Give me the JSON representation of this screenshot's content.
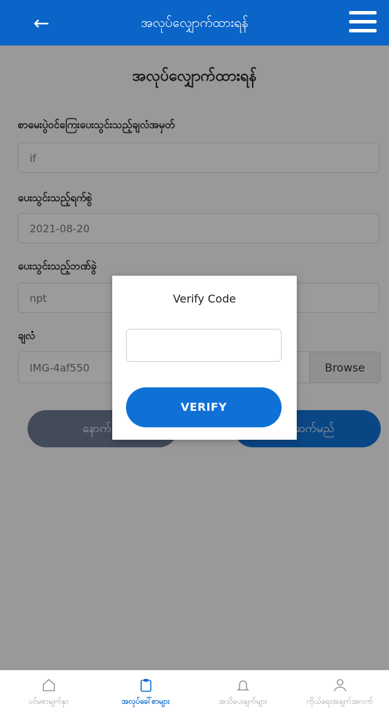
{
  "header": {
    "title": "အလုပ်လျှောက်ထားရန်",
    "back_icon": "arrow-left-icon",
    "menu_icon": "hamburger-menu-icon",
    "bg_color": "#0b64c8"
  },
  "form": {
    "title": "အလုပ်လျှောက်ထားရန်",
    "fields": [
      {
        "label": "စာမေးပွဲဝင်ကြေးပေးသွင်းသည့်ချလံအမှတ်",
        "value": "if"
      },
      {
        "label": "ပေးသွင်းသည့်ရက်စွဲ",
        "value": "2021-08-20"
      },
      {
        "label": "ပေးသွင်းသည့်ဘဏ်ခွဲ",
        "value": "npt"
      }
    ],
    "file": {
      "label": "ချလံ",
      "value": "IMG-4af550",
      "browse_label": "Browse"
    },
    "back_label": "နောက်သို့",
    "next_label": "ရှေ့ဆက်မည်"
  },
  "modal": {
    "title": "Verify Code",
    "input_value": "",
    "button_label": "VERIFY",
    "accent": "#0f71d6"
  },
  "bottom_nav": {
    "items": [
      {
        "label": "ပင်မစာမျက်နှာ",
        "icon": "home-icon"
      },
      {
        "label": "အလုပ်ခေါ်စာများ",
        "icon": "clipboard-icon"
      },
      {
        "label": "အသိပေးချက်များ",
        "icon": "bell-icon"
      },
      {
        "label": "ကိုယ်ရေးအချက်အလက်",
        "icon": "user-icon"
      }
    ]
  }
}
